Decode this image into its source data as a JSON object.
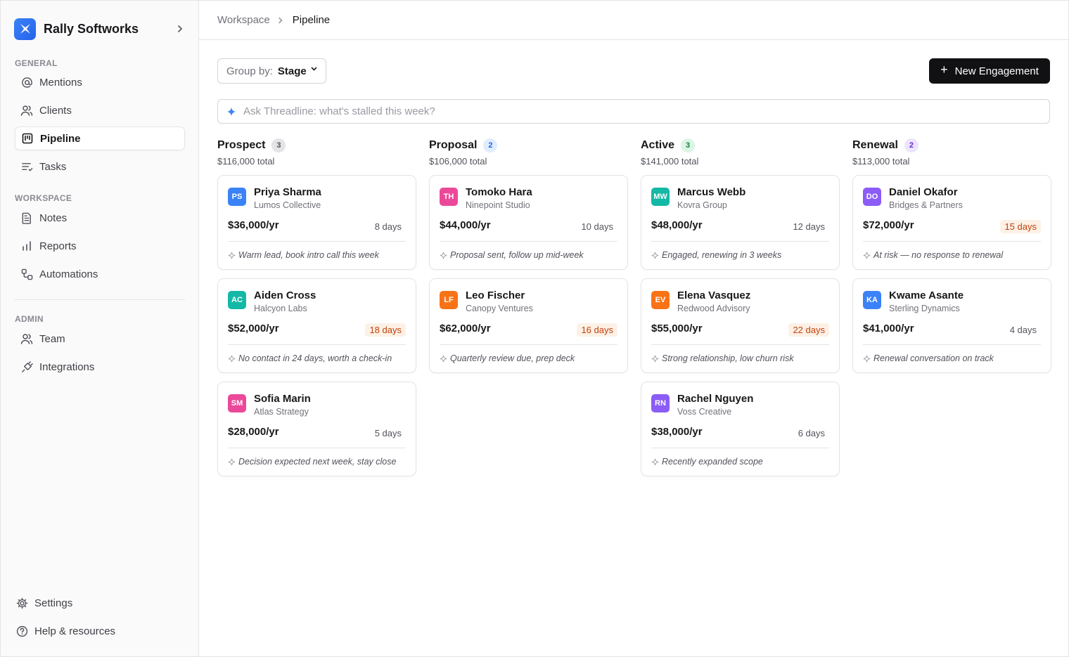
{
  "sidebar": {
    "brand": "Rally Softworks",
    "general_label": "GENERAL",
    "general_items": [
      {
        "label": "Mentions",
        "icon": "at-icon"
      },
      {
        "label": "Clients",
        "icon": "users-icon"
      },
      {
        "label": "Pipeline",
        "icon": "kanban-icon",
        "active": true
      },
      {
        "label": "Tasks",
        "icon": "list-icon"
      }
    ],
    "workspace_label": "WORKSPACE",
    "workspace_items": [
      {
        "label": "Notes",
        "icon": "document-icon"
      },
      {
        "label": "Reports",
        "icon": "bar-chart-icon"
      },
      {
        "label": "Automations",
        "icon": "workflow-icon"
      }
    ],
    "admin_label": "ADMIN",
    "admin_items": [
      {
        "label": "Team",
        "icon": "users-icon"
      },
      {
        "label": "Integrations",
        "icon": "plug-icon"
      }
    ],
    "bottom_items": [
      {
        "label": "Settings",
        "icon": "gear-icon"
      },
      {
        "label": "Help & resources",
        "icon": "help-icon"
      }
    ]
  },
  "breadcrumb": {
    "parent": "Workspace",
    "current": "Pipeline"
  },
  "toolbar": {
    "group_by_label": "Group by:",
    "group_by_value": "Stage",
    "new_button": "New Engagement"
  },
  "ask": {
    "placeholder": "Ask Threadline: what's stalled this week?"
  },
  "colors": {
    "accent": "#3b82f6",
    "button_dark": "#111113",
    "warn_bg": "#fdf1e6",
    "warn_text": "#c2410c"
  },
  "columns": [
    {
      "title": "Prospect",
      "count": "3",
      "total": "$116,000 total",
      "count_bg": "#e4e4e7",
      "count_fg": "#52525b",
      "cards": [
        {
          "initials": "PS",
          "color": "#3b82f6",
          "name": "Priya Sharma",
          "company": "Lumos Collective",
          "amount": "$36,000/yr",
          "days": "8 days",
          "warn": false,
          "note": "Warm lead, book intro call this week"
        },
        {
          "initials": "AC",
          "color": "#14b8a6",
          "name": "Aiden Cross",
          "company": "Halcyon Labs",
          "amount": "$52,000/yr",
          "days": "18 days",
          "warn": true,
          "note": "No contact in 24 days, worth a check-in"
        },
        {
          "initials": "SM",
          "color": "#ec4899",
          "name": "Sofia Marin",
          "company": "Atlas Strategy",
          "amount": "$28,000/yr",
          "days": "5 days",
          "warn": false,
          "note": "Decision expected next week, stay close"
        }
      ]
    },
    {
      "title": "Proposal",
      "count": "2",
      "total": "$106,000 total",
      "count_bg": "#e0edff",
      "count_fg": "#2563eb",
      "cards": [
        {
          "initials": "TH",
          "color": "#ec4899",
          "name": "Tomoko Hara",
          "company": "Ninepoint Studio",
          "amount": "$44,000/yr",
          "days": "10 days",
          "warn": false,
          "note": "Proposal sent, follow up mid-week"
        },
        {
          "initials": "LF",
          "color": "#f97316",
          "name": "Leo Fischer",
          "company": "Canopy Ventures",
          "amount": "$62,000/yr",
          "days": "16 days",
          "warn": true,
          "note": "Quarterly review due, prep deck"
        }
      ]
    },
    {
      "title": "Active",
      "count": "3",
      "total": "$141,000 total",
      "count_bg": "#dcf5e4",
      "count_fg": "#15803d",
      "cards": [
        {
          "initials": "MW",
          "color": "#14b8a6",
          "name": "Marcus Webb",
          "company": "Kovra Group",
          "amount": "$48,000/yr",
          "days": "12 days",
          "warn": false,
          "note": "Engaged, renewing in 3 weeks"
        },
        {
          "initials": "EV",
          "color": "#f97316",
          "name": "Elena Vasquez",
          "company": "Redwood Advisory",
          "amount": "$55,000/yr",
          "days": "22 days",
          "warn": true,
          "note": "Strong relationship, low churn risk"
        },
        {
          "initials": "RN",
          "color": "#8b5cf6",
          "name": "Rachel Nguyen",
          "company": "Voss Creative",
          "amount": "$38,000/yr",
          "days": "6 days",
          "warn": false,
          "note": "Recently expanded scope"
        }
      ]
    },
    {
      "title": "Renewal",
      "count": "2",
      "total": "$113,000 total",
      "count_bg": "#ebe5ff",
      "count_fg": "#6d28d9",
      "cards": [
        {
          "initials": "DO",
          "color": "#8b5cf6",
          "name": "Daniel Okafor",
          "company": "Bridges & Partners",
          "amount": "$72,000/yr",
          "days": "15 days",
          "warn": true,
          "note": "At risk — no response to renewal"
        },
        {
          "initials": "KA",
          "color": "#3b82f6",
          "name": "Kwame Asante",
          "company": "Sterling Dynamics",
          "amount": "$41,000/yr",
          "days": "4 days",
          "warn": false,
          "note": "Renewal conversation on track"
        }
      ]
    }
  ]
}
